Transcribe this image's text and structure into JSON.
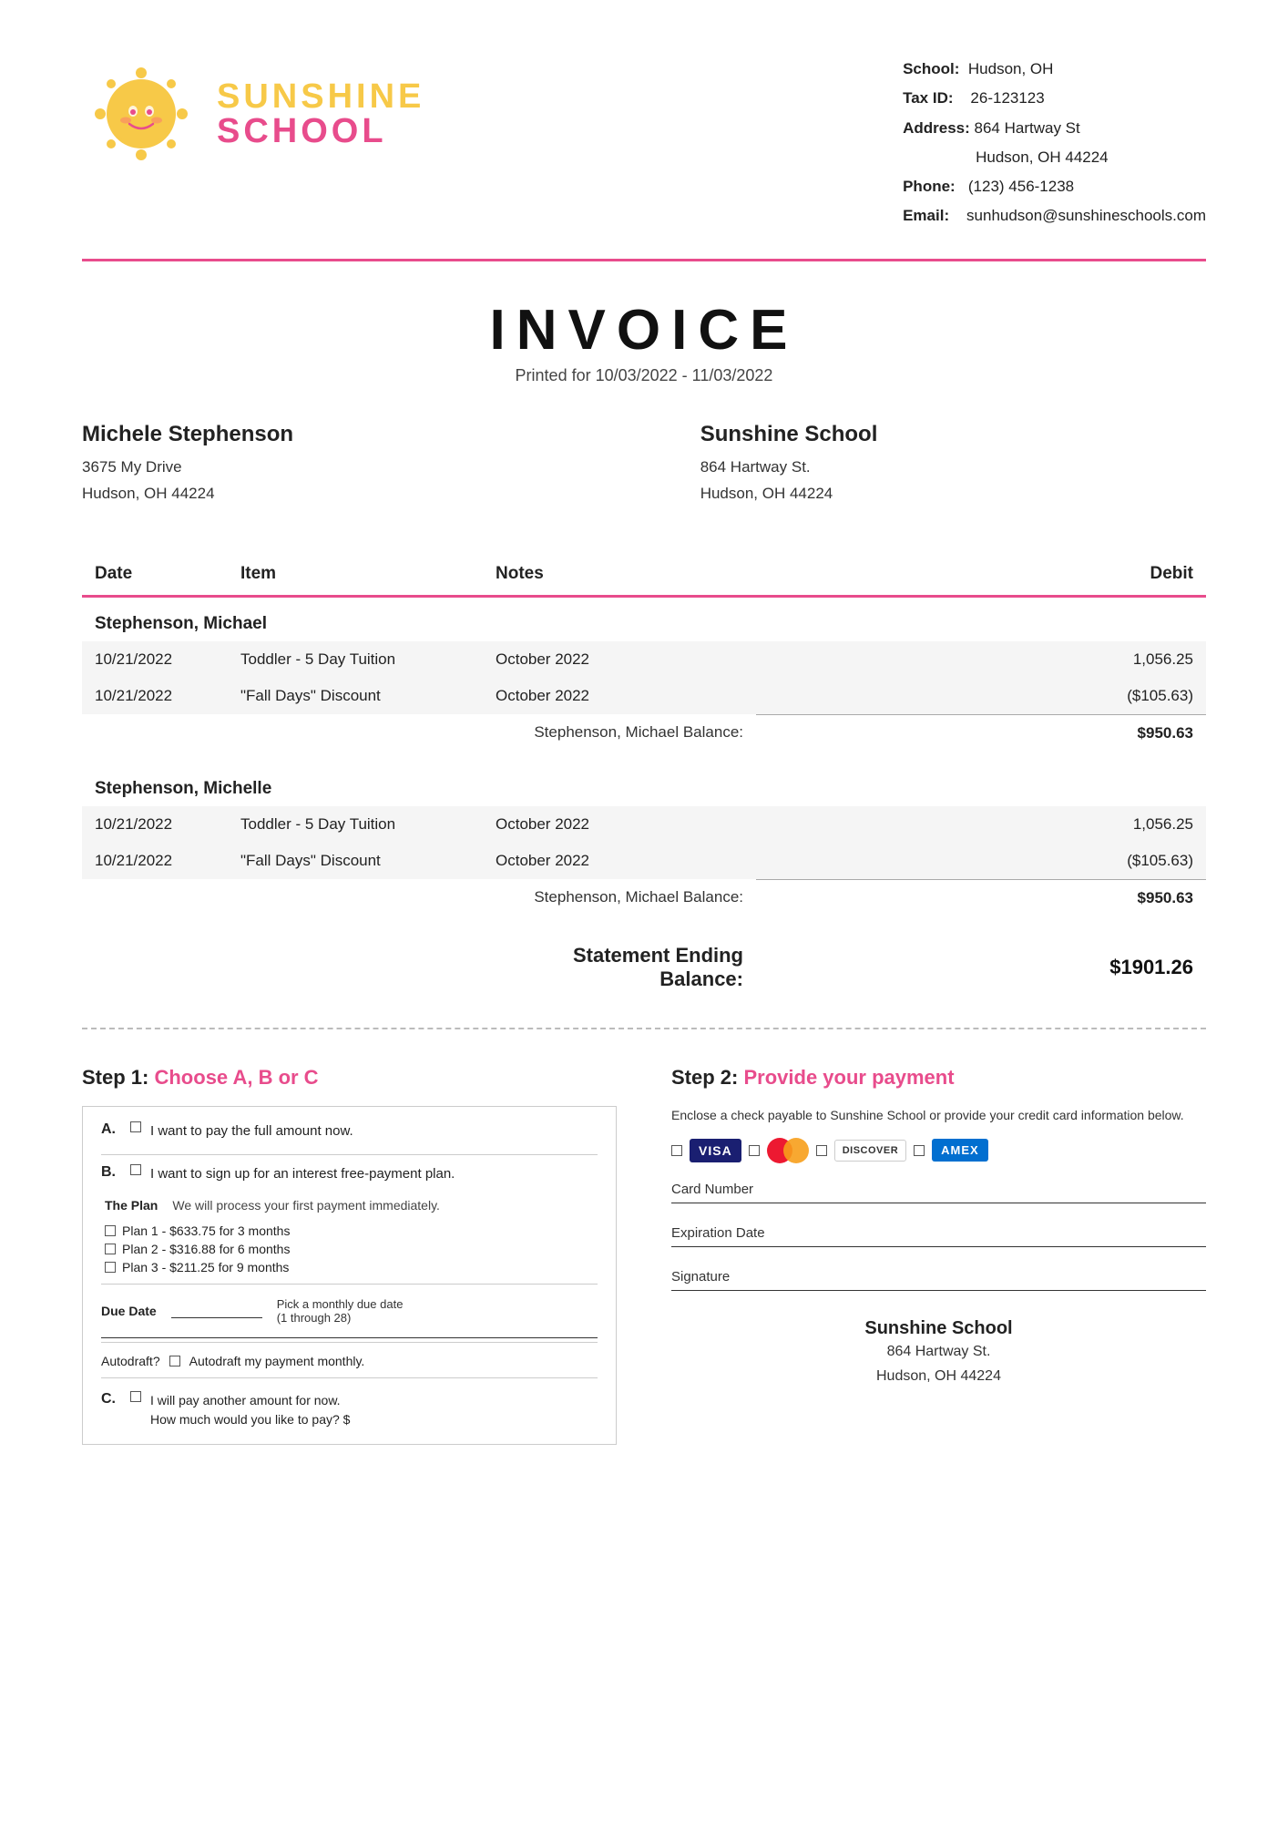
{
  "school": {
    "name": "Sunshine School",
    "logo_sunshine": "SUNSHINE",
    "logo_school": "SCHOOL",
    "location": "Hudson, OH",
    "tax_id": "26-123123",
    "address_line1": "864 Hartway St",
    "address_line2": "Hudson, OH 44224",
    "phone": "(123) 456-1238",
    "email": "sunhudson@sunshineschools.com",
    "address_short1": "864 Hartway St.",
    "address_short2": "Hudson, OH 44224"
  },
  "invoice": {
    "title": "INVOICE",
    "period": "Printed for 10/03/2022 - 11/03/2022"
  },
  "billing": {
    "client_name": "Michele Stephenson",
    "client_addr1": "3675 My Drive",
    "client_addr2": "Hudson, OH  44224",
    "school_name": "Sunshine School",
    "school_addr1": "864 Hartway St.",
    "school_addr2": "Hudson, OH  44224"
  },
  "table": {
    "headers": [
      "Date",
      "Item",
      "Notes",
      "Debit"
    ],
    "sections": [
      {
        "title": "Stephenson, Michael",
        "rows": [
          {
            "date": "10/21/2022",
            "item": "Toddler - 5 Day Tuition",
            "notes": "October 2022",
            "debit": "1,056.25"
          },
          {
            "date": "10/21/2022",
            "item": "\"Fall Days\" Discount",
            "notes": "October 2022",
            "debit": "($105.63)"
          }
        ],
        "balance_label": "Stephenson, Michael Balance:",
        "balance_amount": "$950.63"
      },
      {
        "title": "Stephenson, Michelle",
        "rows": [
          {
            "date": "10/21/2022",
            "item": "Toddler - 5 Day Tuition",
            "notes": "October 2022",
            "debit": "1,056.25"
          },
          {
            "date": "10/21/2022",
            "item": "\"Fall Days\" Discount",
            "notes": "October 2022",
            "debit": "($105.63)"
          }
        ],
        "balance_label": "Stephenson, Michael Balance:",
        "balance_amount": "$950.63"
      }
    ],
    "statement_balance_label": "Statement Ending Balance:",
    "statement_balance_amount": "$1901.26"
  },
  "step1": {
    "heading": "Step 1:",
    "heading_colored": "Choose A, B or C",
    "option_a_label": "A.",
    "option_a_text": "I want to pay the full amount now.",
    "option_b_label": "B.",
    "option_b_text": "I want to sign up for an interest free-payment plan.",
    "plan_label": "The Plan",
    "plan_desc": "We will process your first payment immediately.",
    "plans": [
      "Plan 1 - $633.75 for 3 months",
      "Plan 2 - $316.88 for 6 months",
      "Plan 3 - $211.25 for 9 months"
    ],
    "due_date_label": "Due Date",
    "due_date_desc1": "Pick a monthly due date",
    "due_date_desc2": "(1 through 28)",
    "autodraft_label": "Autodraft?",
    "autodraft_text": "Autodraft my payment monthly.",
    "option_c_label": "C.",
    "option_c_text": "I will pay another amount for now.",
    "option_c_sub": "How much would you like to pay? $"
  },
  "step2": {
    "heading": "Step 2:",
    "heading_colored": "Provide your payment",
    "desc": "Enclose a check payable to Sunshine School or provide your credit card information below.",
    "card_number_label": "Card Number",
    "expiration_label": "Expiration Date",
    "signature_label": "Signature"
  },
  "footer": {
    "school_name": "Sunshine School",
    "addr1": "864 Hartway St.",
    "addr2": "Hudson, OH 44224"
  }
}
